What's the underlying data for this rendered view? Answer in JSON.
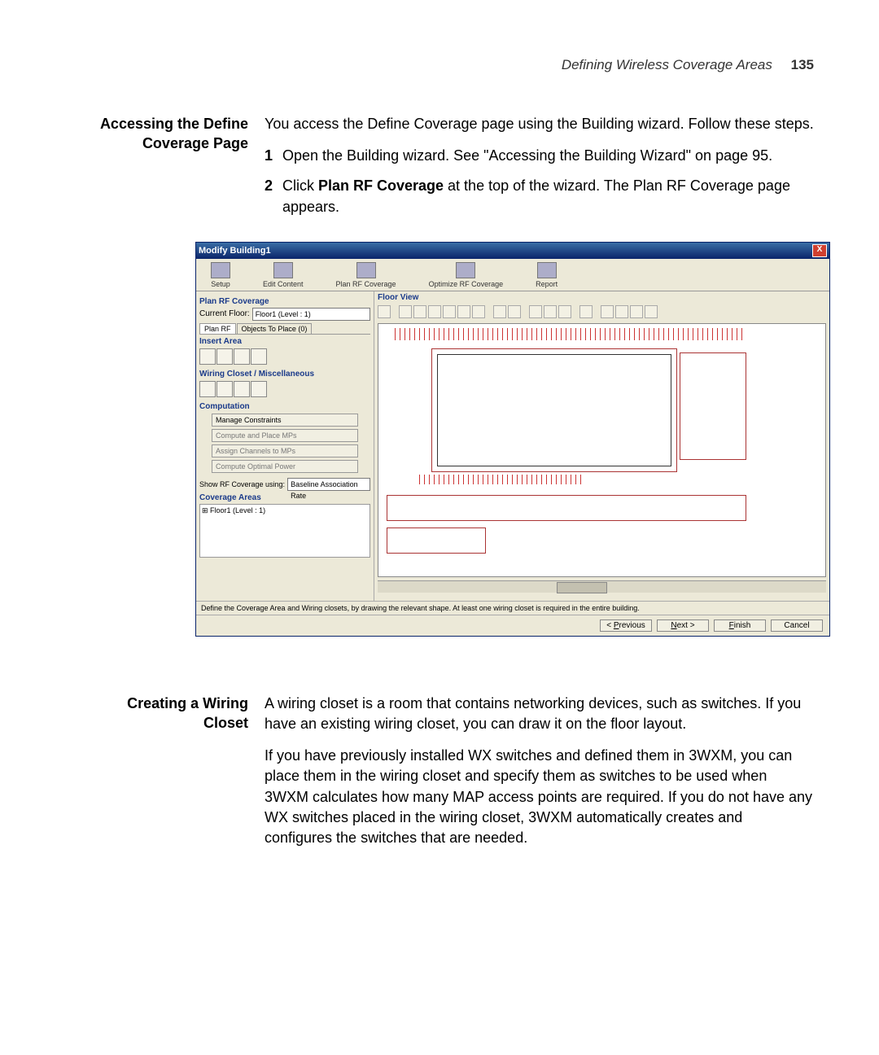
{
  "header": {
    "running": "Defining Wireless Coverage Areas",
    "page_number": "135"
  },
  "sec1": {
    "side_head_l1": "Accessing the Define",
    "side_head_l2": "Coverage Page",
    "intro": "You access the Define Coverage page using the Building wizard. Follow these steps.",
    "step1_num": "1",
    "step1": "Open the Building wizard. See \"Accessing the Building Wizard\" on page 95.",
    "step2_num": "2",
    "step2_pre": "Click ",
    "step2_bold": "Plan RF Coverage",
    "step2_post": " at the top of the wizard. The Plan RF Coverage page appears."
  },
  "screenshot": {
    "title": "Modify Building1",
    "close_x": "X",
    "tabs": {
      "setup": "Setup",
      "edit_content": "Edit Content",
      "plan_rf": "Plan RF Coverage",
      "optimize_rf": "Optimize RF Coverage",
      "report": "Report"
    },
    "group_plan_rf": "Plan RF Coverage",
    "current_floor_label": "Current Floor:",
    "current_floor_value": "Floor1 (Level : 1)",
    "tabstrip": {
      "plan_rf": "Plan RF",
      "objects": "Objects To Place (0)"
    },
    "group_insert": "Insert Area",
    "group_wiring": "Wiring Closet / Miscellaneous",
    "group_computation": "Computation",
    "comp_btns": {
      "manage": "Manage Constraints",
      "compute_place": "Compute and Place MPs",
      "assign": "Assign Channels to MPs",
      "compute_power": "Compute Optimal Power"
    },
    "show_rf_label": "Show RF Coverage using:",
    "show_rf_value": "Baseline Association Rate",
    "group_coverage": "Coverage Areas",
    "tree_item": "Floor1 (Level : 1)",
    "floor_view": "Floor View",
    "hint": "Define the Coverage Area and Wiring closets, by drawing the relevant shape. At least one wiring closet is required in the entire building.",
    "buttons": {
      "previous_u": "P",
      "previous_rest": "revious",
      "previous_lt": "< ",
      "next_u": "N",
      "next_rest": "ext >",
      "finish_u": "F",
      "finish_rest": "inish",
      "cancel": "Cancel"
    }
  },
  "sec2": {
    "side_head_l1": "Creating a Wiring",
    "side_head_l2": "Closet",
    "p1": "A wiring closet is a room that contains networking devices, such as switches. If you have an existing wiring closet, you can draw it on the floor layout.",
    "p2": "If you have previously installed WX switches and defined them in 3WXM, you can place them in the wiring closet and specify them as switches to be used when 3WXM calculates how many MAP access points are required. If you do not have any WX switches placed in the wiring closet, 3WXM automatically creates and configures the switches that are needed."
  }
}
